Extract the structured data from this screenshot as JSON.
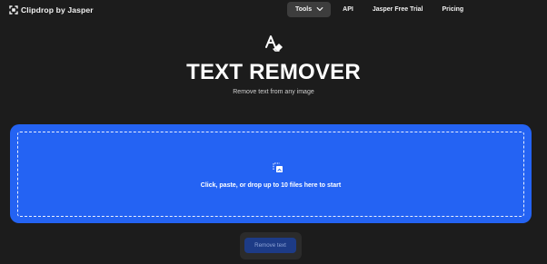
{
  "header": {
    "brand": {
      "name": "Clipdrop by Jasper",
      "logo_icon": "clipdrop-logo-icon"
    },
    "nav": {
      "tools_label": "Tools",
      "tools_chevron_icon": "chevron-down-icon",
      "api_label": "API",
      "jasper_free_trial_label": "Jasper Free Trial",
      "pricing_label": "Pricing"
    }
  },
  "hero": {
    "icon": "text-eraser-icon",
    "title": "TEXT REMOVER",
    "subtitle": "Remove text from any image"
  },
  "dropzone": {
    "icon": "upload-images-icon",
    "instructions": "Click, paste, or drop up to 10 files here to start"
  },
  "actions": {
    "remove_text_label": "Remove text"
  },
  "colors": {
    "background": "#1c1c1c",
    "nav_active": "#3d3d3d",
    "dropzone": "#2463f3",
    "button_disabled": "#1d3b86",
    "button_text_disabled": "#8ea4d7"
  }
}
